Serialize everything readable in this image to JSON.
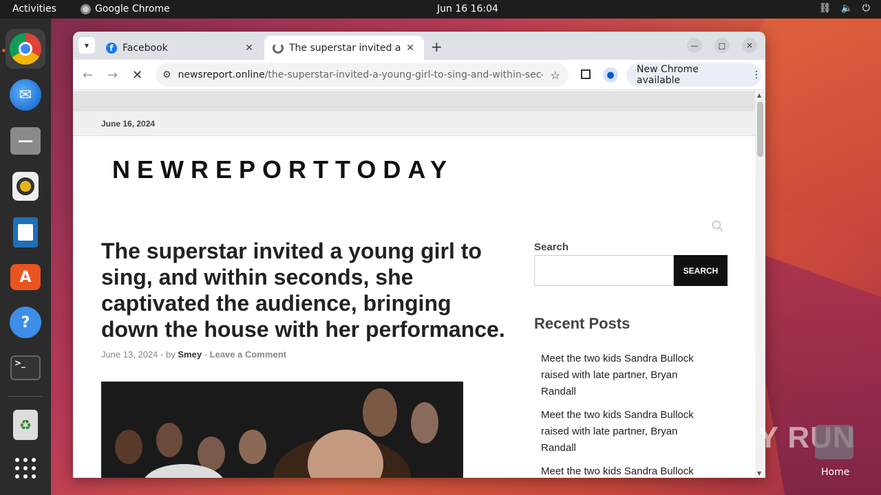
{
  "topbar": {
    "activities": "Activities",
    "app_name": "Google Chrome",
    "clock": "Jun 16  16:04"
  },
  "browser": {
    "tabs": [
      {
        "title": "Facebook"
      },
      {
        "title": "The superstar invited a y"
      }
    ],
    "url_domain": "newsreport.online",
    "url_path": "/the-superstar-invited-a-young-girl-to-sing-and-within-second…",
    "new_chrome_label": "New Chrome available"
  },
  "page": {
    "date": "June 16, 2024",
    "site_title": "NEWREPORTTODAY",
    "article": {
      "title": "The superstar invited a young girl to sing, and within seconds, she captivated the audience, bringing down the house with her performance.",
      "date": "June 13, 2024",
      "by": "by",
      "author": "Smey",
      "comment": "Leave a Comment",
      "sep": "-"
    },
    "sidebar": {
      "search_label": "Search",
      "search_button": "SEARCH",
      "recent_heading": "Recent Posts",
      "posts": [
        "Meet the two kids Sandra Bullock raised with late partner, Bryan Randall",
        "Meet the two kids Sandra Bullock raised with late partner, Bryan Randall",
        "Meet the two kids Sandra Bullock"
      ]
    }
  },
  "desktop": {
    "watermark": "ANY RUN",
    "home_label": "Home"
  }
}
